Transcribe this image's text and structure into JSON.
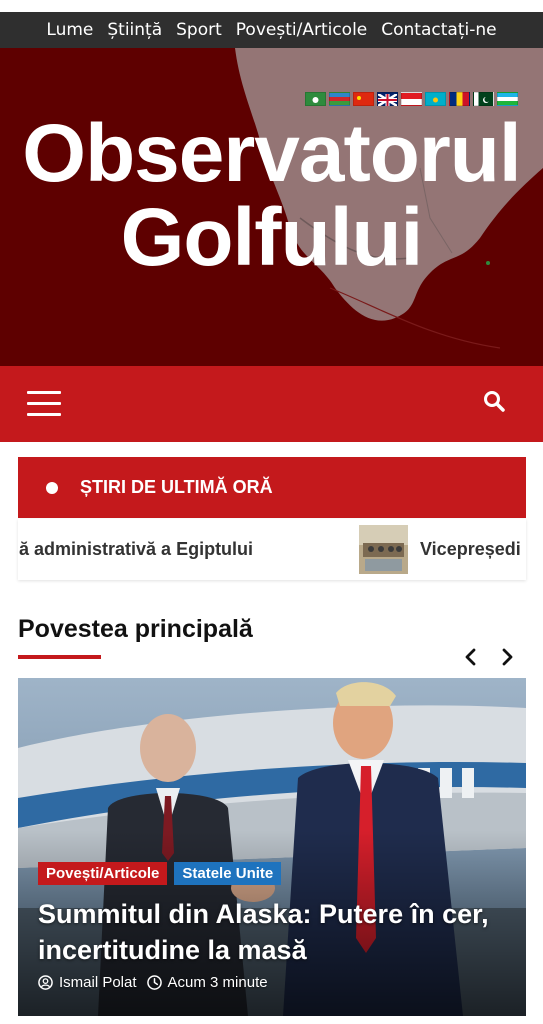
{
  "nav": {
    "items": [
      "Lume",
      "Știință",
      "Sport",
      "Povești/Articole",
      "Contactați-ne"
    ]
  },
  "header": {
    "title_line1": "Observatorul",
    "title_line2": "Golfului",
    "languages": [
      {
        "icon": "flag-arabic",
        "colors": [
          "#2e8b3d",
          "#ffffff"
        ]
      },
      {
        "icon": "flag-azerbaijan",
        "colors": [
          "#2f86c9",
          "#d0262a",
          "#3c9a3c"
        ]
      },
      {
        "icon": "flag-china",
        "colors": [
          "#de2910",
          "#ffde00"
        ]
      },
      {
        "icon": "flag-uk",
        "colors": [
          "#012169",
          "#c8102e",
          "#ffffff"
        ]
      },
      {
        "icon": "flag-indonesia",
        "colors": [
          "#e11b22",
          "#ffffff"
        ]
      },
      {
        "icon": "flag-kazakhstan",
        "colors": [
          "#00afca",
          "#fec50c"
        ]
      },
      {
        "icon": "flag-romania",
        "colors": [
          "#002b7f",
          "#fcd116",
          "#ce1126"
        ]
      },
      {
        "icon": "flag-pakistan",
        "colors": [
          "#01411c",
          "#ffffff"
        ]
      },
      {
        "icon": "flag-uzbekistan",
        "colors": [
          "#1eb5e7",
          "#ffffff",
          "#1eb53a"
        ]
      }
    ]
  },
  "toolbar": {
    "menu_icon": "hamburger-menu-icon",
    "search_icon": "search-icon"
  },
  "breaking": {
    "label": "ȘTIRI DE ULTIMĂ ORĂ",
    "ticker_items": [
      "lă administrativă a Egiptului",
      "Vicepreședi"
    ]
  },
  "section": {
    "title": "Povestea principală",
    "prev_icon": "chevron-left-icon",
    "next_icon": "chevron-right-icon"
  },
  "main_story": {
    "categories": [
      "Povești/Articole",
      "Statele Unite"
    ],
    "headline": "Summitul din Alaska: Putere în cer, incertitudine la masă",
    "author": "Ismail Polat",
    "time": "Acum 3 minute"
  },
  "colors": {
    "brand_red": "#c4191c",
    "nav_dark": "#2f2f2f",
    "hero_dark_red": "#5a0000",
    "category_blue": "#1e73be"
  }
}
